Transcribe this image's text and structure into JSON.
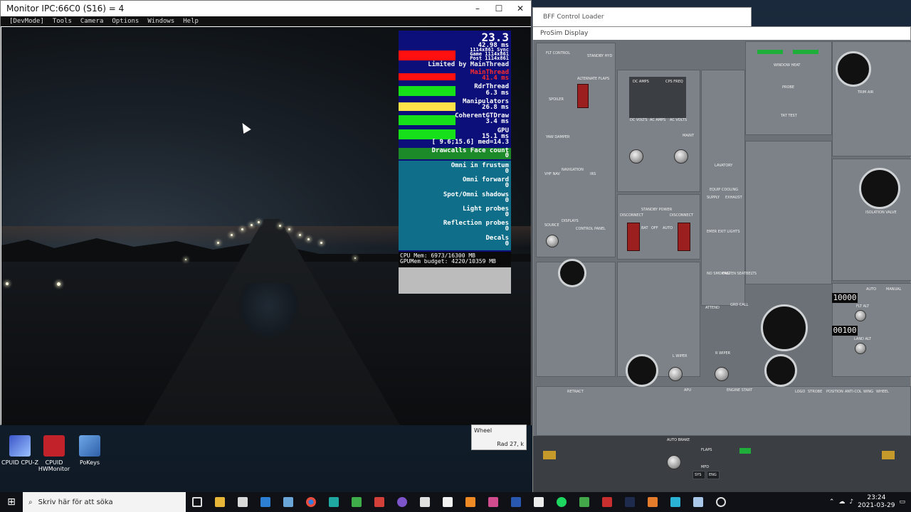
{
  "monitor_window": {
    "title": "Monitor IPC:66C0 (S16) = 4",
    "menu": [
      "[DevMode]",
      "Tools",
      "Camera",
      "Options",
      "Windows",
      "Help"
    ],
    "controls": {
      "minimize": "–",
      "maximize": "☐",
      "close": "✕"
    }
  },
  "stats": {
    "fps": "23.3",
    "frame_ms": "42.98 ms",
    "sync": "1114x861 Sync",
    "game": "Game 1114x861",
    "post": "Post 1114x861",
    "limited": "Limited by MainThread",
    "main_thread_label": "MainThread",
    "main_thread_value": "41.4 ms",
    "rdr_thread_label": "RdrThread",
    "rdr_thread_value": "6.3 ms",
    "manipulators_label": "Manipulators",
    "manipulators_value": "26.8 ms",
    "coherent_label": "CoherentGTDraw",
    "coherent_value": "3.4 ms",
    "gpu_label": "GPU",
    "gpu_value": "15.1 ms",
    "range": "[ 9.6;15.6] med=14.3",
    "drawcalls_label": "Drawcalls Face count",
    "drawcalls_value": "0",
    "rows": [
      {
        "label": "Omni in frustum",
        "value": "0"
      },
      {
        "label": "Omni forward",
        "value": "0"
      },
      {
        "label": "Spot/Omni shadows",
        "value": "0"
      },
      {
        "label": "Light probes",
        "value": "0"
      },
      {
        "label": "Reflection probes",
        "value": "0"
      },
      {
        "label": "Decals",
        "value": "0"
      }
    ],
    "cpu_mem": "CPU Mem: 6973/16300 MB",
    "gpu_mem": "GPUMem budget: 4220/10359 MB",
    "colors": {
      "red": "#ff1010",
      "green": "#16e01a",
      "yellow": "#ffe14a",
      "blue": "#0c0f7a",
      "teal": "#0f6f8b"
    }
  },
  "bff_window": {
    "title": "BFF Control Loader"
  },
  "prosim_window": {
    "title": "ProSim Display"
  },
  "overhead": {
    "labels": [
      "FLT CONTROL",
      "STANDBY HYD",
      "ALTERNATE FLAPS",
      "SPOILER",
      "YAW DAMPER",
      "DC AMPS",
      "CPS FREQ",
      "DC VOLTS",
      "AC AMPS",
      "AC VOLTS",
      "MAINT",
      "NAVIGATION",
      "VHF NAV",
      "IRS",
      "DISPLAYS",
      "SOURCE",
      "CONTROL PANEL",
      "STANDBY POWER",
      "DISCONNECT",
      "BAT",
      "OFF",
      "AUTO",
      "LAVATORY",
      "EQUIP COOLING",
      "SUPPLY",
      "EXHAUST",
      "EMER EXIT LIGHTS",
      "NO SMOKING",
      "FASTEN SEATBELTS",
      "ATTEND",
      "GRD CALL",
      "WINDOW HEAT",
      "PROBE",
      "TAT TEST",
      "TRIM AIR",
      "ISOLATION VALVE",
      "AUTO",
      "MANUAL",
      "FLT ALT",
      "LAND ALT",
      "L WIPER",
      "R WIPER",
      "APU",
      "ENGINE START",
      "RETRACT",
      "LOGO",
      "STROBE",
      "POSITION",
      "ANTI-COL",
      "WING",
      "WHEEL",
      "AUTO BRAKE",
      "FLAPS",
      "MFD",
      "SYS",
      "ENG"
    ],
    "flt_alt": "10000",
    "land_alt": "00100"
  },
  "small_window": {
    "line1": "Wheel",
    "line2": "Rad 27, k"
  },
  "desktop_icons": [
    {
      "label": "CPUID CPU-Z"
    },
    {
      "label": "CPUID HWMonitor"
    },
    {
      "label": "PoKeys"
    }
  ],
  "taskbar": {
    "search_placeholder": "Skriv här för att söka",
    "time": "23:24",
    "date": "2021-03-29"
  }
}
